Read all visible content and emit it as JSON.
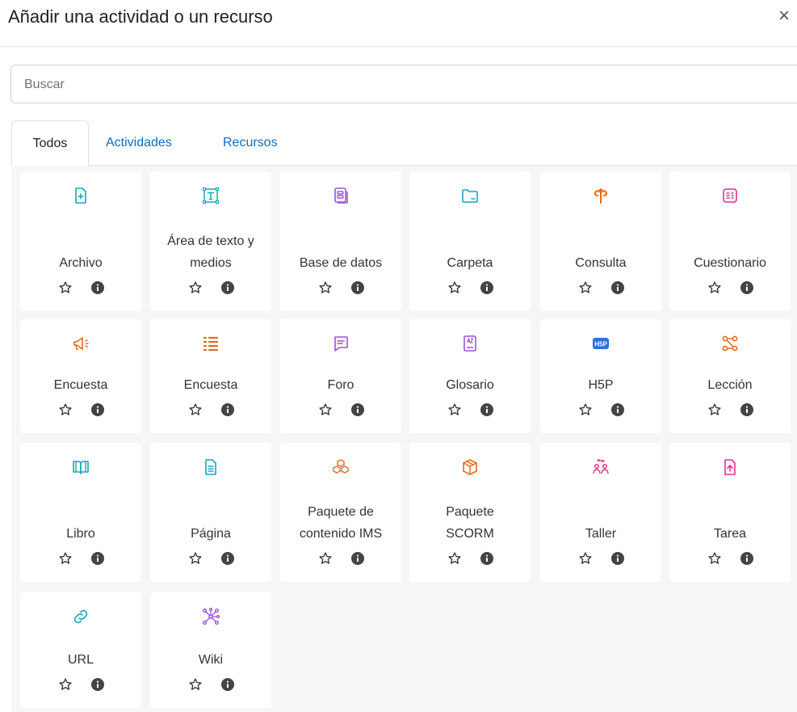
{
  "modal": {
    "title": "Añadir una actividad o un recurso",
    "close": "×"
  },
  "search": {
    "placeholder": "Buscar",
    "value": ""
  },
  "tabs": [
    {
      "label": "Todos",
      "active": true
    },
    {
      "label": "Actividades",
      "active": false
    },
    {
      "label": "Recursos",
      "active": false
    }
  ],
  "colors": {
    "teal": "#1aa6b7",
    "purple": "#9b51e0",
    "orange": "#e76b1a",
    "pink": "#e62e8a",
    "blue": "#2f6fde",
    "link": "#0f6cbf"
  },
  "items": [
    {
      "label": "Archivo",
      "icon": "file-plus-icon",
      "color": "#1aa6b7"
    },
    {
      "label": "Área de texto y\nmedios",
      "icon": "text-area-icon",
      "color": "#1aa6b7"
    },
    {
      "label": "Base de datos",
      "icon": "database-icon",
      "color": "#9b51e0"
    },
    {
      "label": "Carpeta",
      "icon": "folder-icon",
      "color": "#1aa6b7"
    },
    {
      "label": "Consulta",
      "icon": "choice-icon",
      "color": "#e76b1a"
    },
    {
      "label": "Cuestionario",
      "icon": "quiz-icon",
      "color": "#e62e8a"
    },
    {
      "label": "Encuesta",
      "icon": "megaphone-icon",
      "color": "#e76b1a"
    },
    {
      "label": "Encuesta",
      "icon": "survey-list-icon",
      "color": "#e76b1a"
    },
    {
      "label": "Foro",
      "icon": "forum-icon",
      "color": "#9b51e0"
    },
    {
      "label": "Glosario",
      "icon": "glossary-icon",
      "color": "#9b51e0"
    },
    {
      "label": "H5P",
      "icon": "h5p-icon",
      "color": "#2f6fde"
    },
    {
      "label": "Lección",
      "icon": "lesson-icon",
      "color": "#e76b1a"
    },
    {
      "label": "Libro",
      "icon": "book-icon",
      "color": "#1aa6b7"
    },
    {
      "label": "Página",
      "icon": "page-icon",
      "color": "#1aa6b7"
    },
    {
      "label": "Paquete de\ncontenido IMS",
      "icon": "ims-package-icon",
      "color": "#e76b1a"
    },
    {
      "label": "Paquete\nSCORM",
      "icon": "scorm-package-icon",
      "color": "#e76b1a"
    },
    {
      "label": "Taller",
      "icon": "workshop-icon",
      "color": "#e62e8a"
    },
    {
      "label": "Tarea",
      "icon": "assignment-icon",
      "color": "#e62e8a"
    },
    {
      "label": "URL",
      "icon": "link-icon",
      "color": "#1aa6b7"
    },
    {
      "label": "Wiki",
      "icon": "wiki-icon",
      "color": "#9b51e0"
    }
  ]
}
